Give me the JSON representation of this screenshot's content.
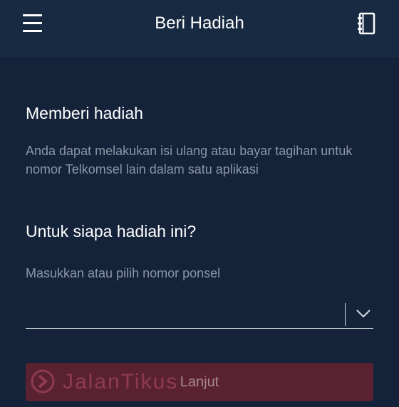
{
  "header": {
    "title": "Beri Hadiah",
    "menu_icon": "hamburger-menu-icon",
    "contacts_icon": "phonebook-icon"
  },
  "gift_section": {
    "title": "Memberi hadiah",
    "description": "Anda dapat melakukan isi ulang atau bayar tagihan untuk nomor Telkomsel lain dalam satu aplikasi"
  },
  "recipient_section": {
    "title": "Untuk siapa hadiah ini?",
    "field_label": "Masukkan atau pilih nomor ponsel",
    "input_value": "",
    "dropdown_icon": "chevron-down-icon"
  },
  "submit": {
    "label": "Lanjut"
  },
  "watermark": {
    "text": "JalanTikus"
  },
  "colors": {
    "background": "#14233a",
    "header": "#182a42",
    "button_disabled": "#5a2231",
    "muted_text": "#8b96a6"
  }
}
